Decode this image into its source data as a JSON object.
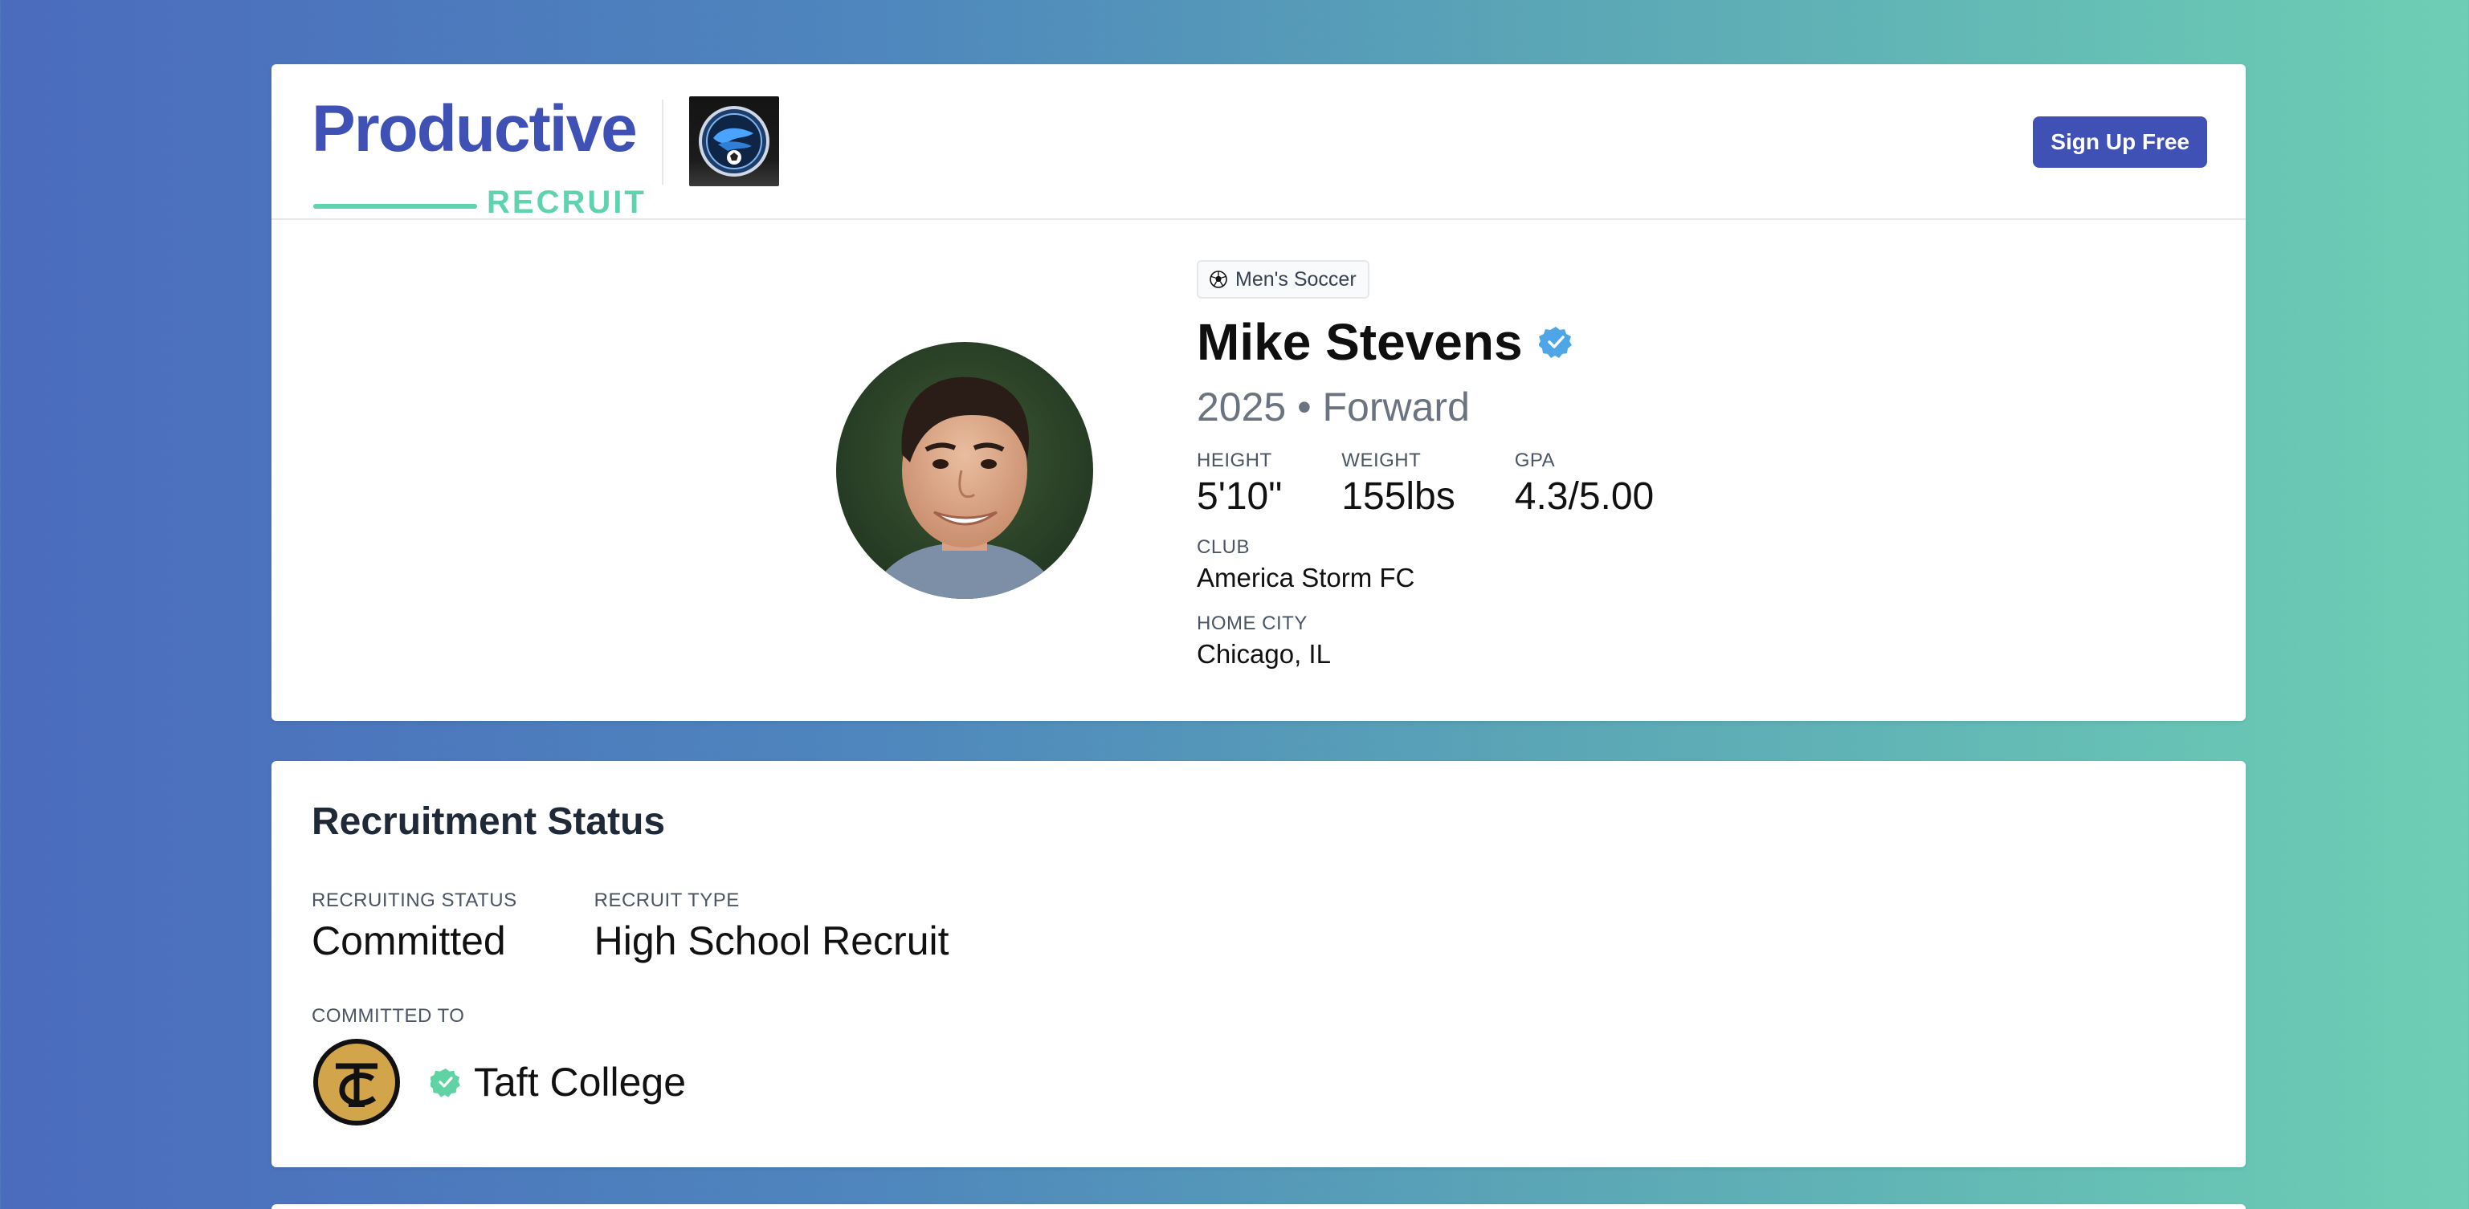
{
  "brand": {
    "logo_word": "Productive",
    "logo_sub": "RECRUIT",
    "primary_color": "#3f51b5",
    "accent_color": "#5fd3b0"
  },
  "header": {
    "signup_label": "Sign Up Free"
  },
  "profile": {
    "sport_tag": "Men's Soccer",
    "sport_icon": "soccer-ball-icon",
    "name": "Mike Stevens",
    "verified_icon": "verified-badge-icon",
    "subline": "2025 • Forward",
    "stats": [
      {
        "label": "HEIGHT",
        "value": "5'10\""
      },
      {
        "label": "WEIGHT",
        "value": "155lbs"
      },
      {
        "label": "GPA",
        "value": "4.3/5.00"
      }
    ],
    "club": {
      "label": "CLUB",
      "value": "America Storm FC"
    },
    "home_city": {
      "label": "HOME CITY",
      "value": "Chicago, IL"
    }
  },
  "recruitment": {
    "title": "Recruitment Status",
    "items": [
      {
        "label": "RECRUITING STATUS",
        "value": "Committed"
      },
      {
        "label": "RECRUIT TYPE",
        "value": "High School Recruit"
      }
    ],
    "committed_label": "COMMITTED TO",
    "college_name": "Taft College",
    "college_logo_text": "TC"
  }
}
